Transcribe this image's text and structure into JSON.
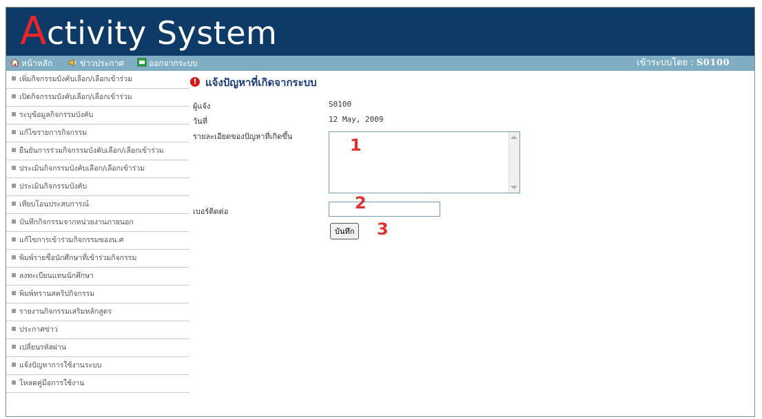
{
  "app": {
    "logo_initial": "A",
    "logo_rest": "ctivity System"
  },
  "navbar": {
    "items": [
      {
        "label": "หน้าหลัก",
        "icon": "home-icon"
      },
      {
        "label": "ข่าวประกาศ",
        "icon": "speaker-icon"
      },
      {
        "label": "ออกจากระบบ",
        "icon": "exit-icon"
      }
    ],
    "user_label": "เข้าระบบโดย :",
    "user_id": "S0100"
  },
  "sidebar": {
    "items": [
      {
        "label": "เพิ่มกิจกรรมบังคับเลือก/เลือกเข้าร่วม"
      },
      {
        "label": "เปิดกิจกรรมบังคับเลือก/เลือกเข้าร่วม"
      },
      {
        "label": "ระบุข้อมูลกิจกรรมบังคับ"
      },
      {
        "label": "แก้ไขรายการกิจกรรม"
      },
      {
        "label": "ยืนยันการร่วมกิจกรรมบังคับเลือก/เลือกเข้าร่วม"
      },
      {
        "label": "ประเมินกิจกรรมบังคับเลือก/เลือกเข้าร่วม"
      },
      {
        "label": "ประเมินกิจกรรมบังคับ"
      },
      {
        "label": "เทียบโอนประสบการณ์"
      },
      {
        "label": "บันทึกกิจกรรมจากหน่วยงานภายนอก"
      },
      {
        "label": "แก้ไขการเข้าร่วมกิจกรรมของน.ศ"
      },
      {
        "label": "พิมพ์รายชื่อนักศึกษาที่เข้าร่วมกิจกรรม"
      },
      {
        "label": "ลงทะเบียนแทนนักศึกษา"
      },
      {
        "label": "พิมพ์ทรานสคริปกิจกรรม"
      },
      {
        "label": "รายงานกิจกรรมเสริมหลักสูตร"
      },
      {
        "label": "ประกาศข่าว"
      },
      {
        "label": "เปลี่ยนรหัสผ่าน"
      },
      {
        "label": "แจ้งปัญหาการใช้งานระบบ"
      },
      {
        "label": "โหลดคู่มือการใช้งาน"
      }
    ]
  },
  "form": {
    "title": "แจ้งปัญหาที่เกิดจากระบบ",
    "reporter_label": "ผู้แจ้ง",
    "reporter_value": "S0100",
    "date_label": "วันที่",
    "date_value": "12 May, 2009",
    "detail_label": "รายละเอียดของปัญหาที่เกิดขึ้น",
    "detail_value": "",
    "phone_label": "เบอร์ติดต่อ",
    "phone_value": "",
    "save_label": "บันทึก"
  },
  "annotations": {
    "marker_1": "1",
    "marker_2": "2",
    "marker_3": "3"
  },
  "colors": {
    "header_bg": "#0d3a66",
    "navbar_bg": "#7faec4",
    "logo_accent": "#e8262a",
    "marker": "#e0322f"
  }
}
